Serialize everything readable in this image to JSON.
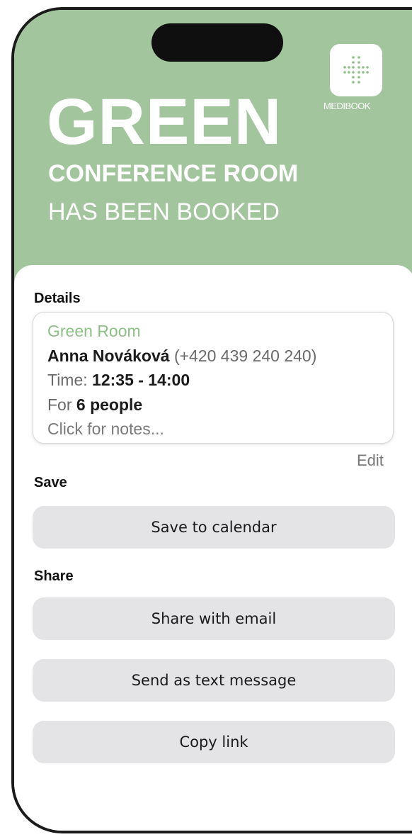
{
  "header": {
    "background_color": "#a3c59e",
    "brand": {
      "name": "MEDIBOOK",
      "icon": "cross-logo-icon"
    },
    "title": "GREEN",
    "subtitle": "CONFERENCE ROOM",
    "status": "HAS BEEN BOOKED"
  },
  "details": {
    "heading": "Details",
    "room": "Green Room",
    "booker_name": "Anna Nováková",
    "booker_phone": "(+420 439 240 240)",
    "time_label": "Time:",
    "time_value": "12:35 - 14:00",
    "people_prefix": "For",
    "people_value": "6 people",
    "notes_placeholder": "Click for notes...",
    "edit_label": "Edit"
  },
  "save": {
    "heading": "Save",
    "calendar_button": "Save to calendar"
  },
  "share": {
    "heading": "Share",
    "email_button": "Share with email",
    "text_button": "Send as text message",
    "copy_button": "Copy link"
  },
  "colors": {
    "accent_green": "#8dbf86",
    "button_gray": "#e4e3e6"
  }
}
